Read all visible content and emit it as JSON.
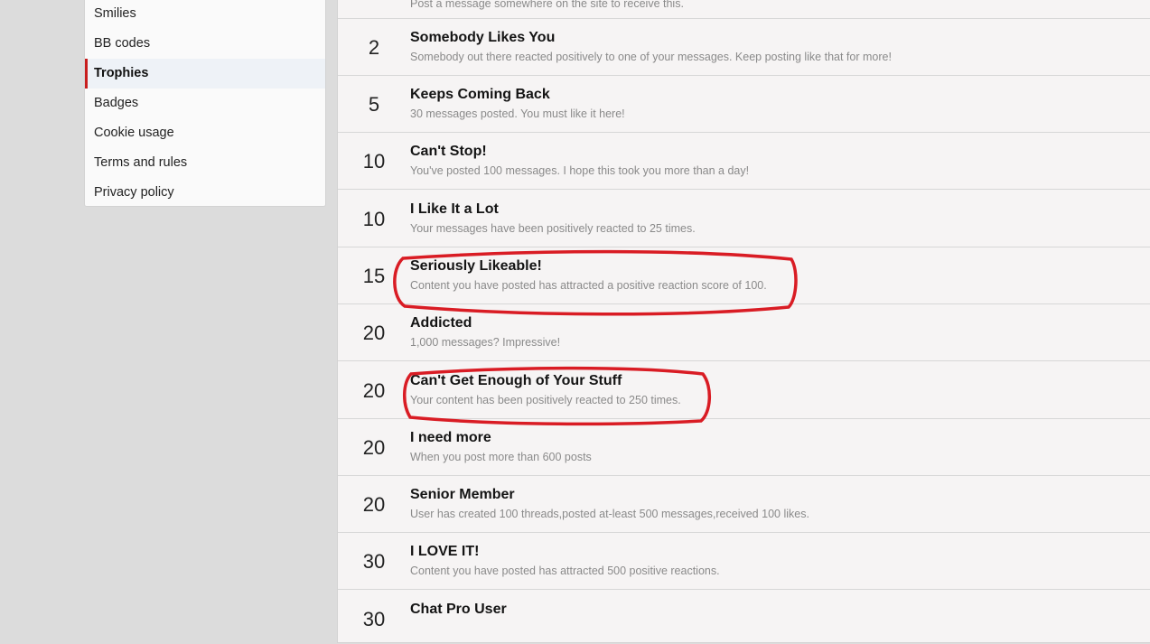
{
  "sidebar": {
    "items": [
      {
        "label": "Smilies",
        "active": false
      },
      {
        "label": "BB codes",
        "active": false
      },
      {
        "label": "Trophies",
        "active": true
      },
      {
        "label": "Badges",
        "active": false
      },
      {
        "label": "Cookie usage",
        "active": false
      },
      {
        "label": "Terms and rules",
        "active": false
      },
      {
        "label": "Privacy policy",
        "active": false
      }
    ]
  },
  "trophies": {
    "partial_desc": "Post a message somewhere on the site to receive this.",
    "rows": [
      {
        "points": "2",
        "title": "Somebody Likes You",
        "desc": "Somebody out there reacted positively to one of your messages. Keep posting like that for more!"
      },
      {
        "points": "5",
        "title": "Keeps Coming Back",
        "desc": "30 messages posted. You must like it here!"
      },
      {
        "points": "10",
        "title": "Can't Stop!",
        "desc": "You've posted 100 messages. I hope this took you more than a day!"
      },
      {
        "points": "10",
        "title": "I Like It a Lot",
        "desc": "Your messages have been positively reacted to 25 times."
      },
      {
        "points": "15",
        "title": "Seriously Likeable!",
        "desc": "Content you have posted has attracted a positive reaction score of 100."
      },
      {
        "points": "20",
        "title": "Addicted",
        "desc": "1,000 messages? Impressive!"
      },
      {
        "points": "20",
        "title": "Can't Get Enough of Your Stuff",
        "desc": "Your content has been positively reacted to 250 times."
      },
      {
        "points": "20",
        "title": "I need more",
        "desc": "When you post more than 600 posts"
      },
      {
        "points": "20",
        "title": "Senior Member",
        "desc": "User has created 100 threads,posted at-least 500 messages,received 100 likes."
      },
      {
        "points": "30",
        "title": "I LOVE IT!",
        "desc": "Content you have posted has attracted 500 positive reactions."
      },
      {
        "points": "30",
        "title": "Chat Pro User",
        "desc": ""
      }
    ]
  },
  "colors": {
    "accent": "#c81e1e",
    "annotation": "#d91c24",
    "description_text": "#8a8a8a"
  }
}
